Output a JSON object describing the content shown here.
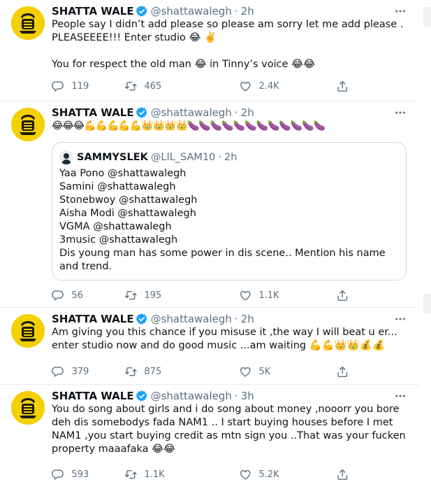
{
  "tweets": [
    {
      "name": "SHATTA WALE",
      "handle": "@shattawalegh",
      "time": "2h",
      "text": "People say I didn’t add please so please am sorry let me add please .\nPLEASEEEE!!!  Enter studio 😂 ✌️\n\nYou for  respect the old man 😂 in Tinny’s voice 😂😂",
      "replies": "119",
      "retweets": "465",
      "likes": "2.4K"
    },
    {
      "name": "SHATTA WALE",
      "handle": "@shattawalegh",
      "time": "2h",
      "text": "😂😂😂💪💪💪💪💪👑👑👑👑🍆🍆🍆🍆🍆🍆🍆🍆🍆🍆🍆🍆",
      "quote": {
        "name": "SAMMYSLEK",
        "handle": "@LIL_SAM10",
        "time": "2h",
        "text": "Yaa Pono @shattawalegh\nSamini @shattawalegh\nStonebwoy @shattawalegh\nAisha Modi @shattawalegh\nVGMA @shattawalegh\n3music @shattawalegh\nDis young man has some power in dis scene.. Mention his name and trend."
      },
      "replies": "56",
      "retweets": "195",
      "likes": "1.1K"
    },
    {
      "name": "SHATTA WALE",
      "handle": "@shattawalegh",
      "time": "2h",
      "text": "Am giving you this chance if you misuse it ,the way I will beat u er... enter studio now and do good music ...am waiting 💪💪👑👑💰💰",
      "replies": "379",
      "retweets": "875",
      "likes": "5K"
    },
    {
      "name": "SHATTA WALE",
      "handle": "@shattawalegh",
      "time": "3h",
      "text": "You do song about girls and i do song about money ,nooorr you bore deh dis somebodys fada NAM1 .. I start buying houses before I met NAM1 ,you start buying credit as mtn sign you ..That was your fucken property maaafaka 😂😂",
      "replies": "593",
      "retweets": "1.1K",
      "likes": "5.2K"
    }
  ],
  "colors": {
    "text": "#0f1419",
    "secondary": "#5b7083",
    "verified": "#1da1f2",
    "avatar_bg": "#f4d000",
    "divider": "#e6ecf0"
  },
  "icons": {
    "reply": "reply-icon",
    "retweet": "retweet-icon",
    "like": "like-icon",
    "share": "share-icon",
    "more": "more-icon",
    "verified": "verified-badge-icon"
  }
}
